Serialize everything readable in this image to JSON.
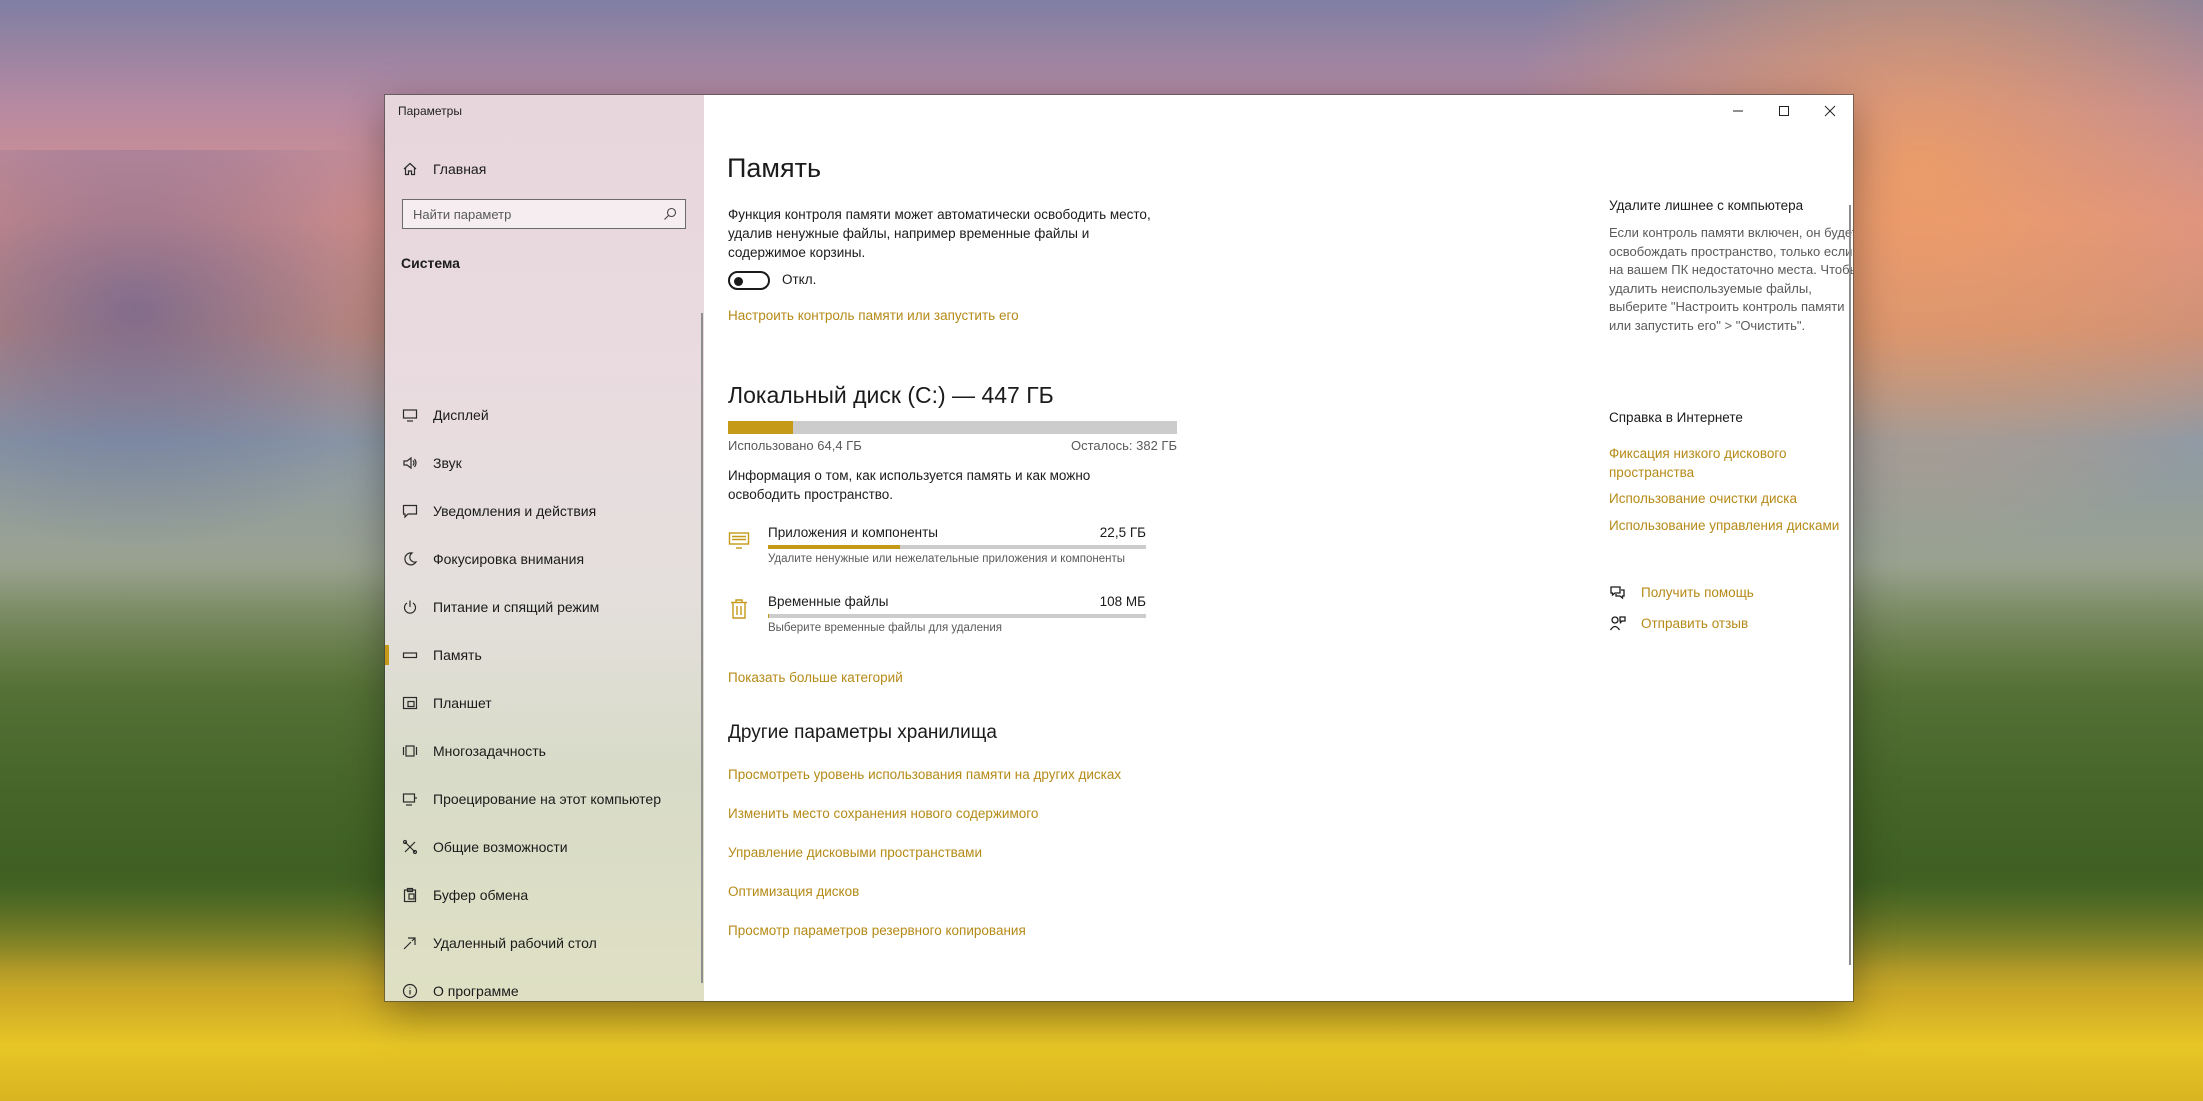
{
  "window": {
    "title": "Параметры"
  },
  "sidebar": {
    "home_label": "Главная",
    "search_placeholder": "Найти параметр",
    "section": "Система",
    "items": [
      {
        "label": "Дисплей",
        "icon": "display-icon"
      },
      {
        "label": "Звук",
        "icon": "speaker-icon"
      },
      {
        "label": "Уведомления и действия",
        "icon": "notification-icon"
      },
      {
        "label": "Фокусировка внимания",
        "icon": "moon-icon"
      },
      {
        "label": "Питание и спящий режим",
        "icon": "power-icon"
      },
      {
        "label": "Память",
        "icon": "storage-icon",
        "active": true
      },
      {
        "label": "Планшет",
        "icon": "tablet-icon"
      },
      {
        "label": "Многозадачность",
        "icon": "multitasking-icon"
      },
      {
        "label": "Проецирование на этот компьютер",
        "icon": "projecting-icon"
      },
      {
        "label": "Общие возможности",
        "icon": "shared-experiences-icon"
      },
      {
        "label": "Буфер обмена",
        "icon": "clipboard-icon"
      },
      {
        "label": "Удаленный рабочий стол",
        "icon": "remote-desktop-icon"
      },
      {
        "label": "О программе",
        "icon": "info-icon"
      }
    ]
  },
  "main": {
    "title": "Память",
    "description": "Функция контроля памяти может автоматически освободить место, удалив ненужные файлы, например временные файлы и содержимое корзины.",
    "toggle": {
      "state_label": "Откл.",
      "on": false
    },
    "configure_link": "Настроить контроль памяти или запустить его",
    "disk": {
      "title": "Локальный диск (C:) — 447 ГБ",
      "used_label": "Использовано 64,4 ГБ",
      "free_label": "Осталось: 382 ГБ",
      "used_fraction": 0.144,
      "info": "Информация о том, как используется память и как можно освободить пространство."
    },
    "categories": [
      {
        "name": "Приложения и компоненты",
        "size": "22,5 ГБ",
        "sub": "Удалите ненужные или нежелательные приложения и компоненты",
        "fraction": 0.35,
        "icon": "apps-icon"
      },
      {
        "name": "Временные файлы",
        "size": "108 МБ",
        "sub": "Выберите временные файлы для удаления",
        "fraction": 0.002,
        "icon": "trash-icon"
      }
    ],
    "more_categories_link": "Показать больше категорий",
    "other_title": "Другие параметры хранилища",
    "other_links": [
      "Просмотреть уровень использования памяти на других дисках",
      "Изменить место сохранения нового содержимого",
      "Управление дисковыми пространствами",
      "Оптимизация дисков",
      "Просмотр параметров резервного копирования"
    ]
  },
  "aside": {
    "cleanup_title": "Удалите лишнее с компьютера",
    "cleanup_text": "Если контроль памяти включен, он будет освобождать пространство, только если на вашем ПК недостаточно места. Чтобы удалить неиспользуемые файлы, выберите \"Настроить контроль памяти или запустить его\" > \"Очистить\".",
    "help_title": "Справка в Интернете",
    "help_links": [
      "Фиксация низкого дискового пространства",
      "Использование очистки диска",
      "Использование управления дисками"
    ],
    "get_help": "Получить помощь",
    "feedback": "Отправить отзыв"
  },
  "colors": {
    "accent": "#c49a18",
    "link": "#b58a17"
  }
}
